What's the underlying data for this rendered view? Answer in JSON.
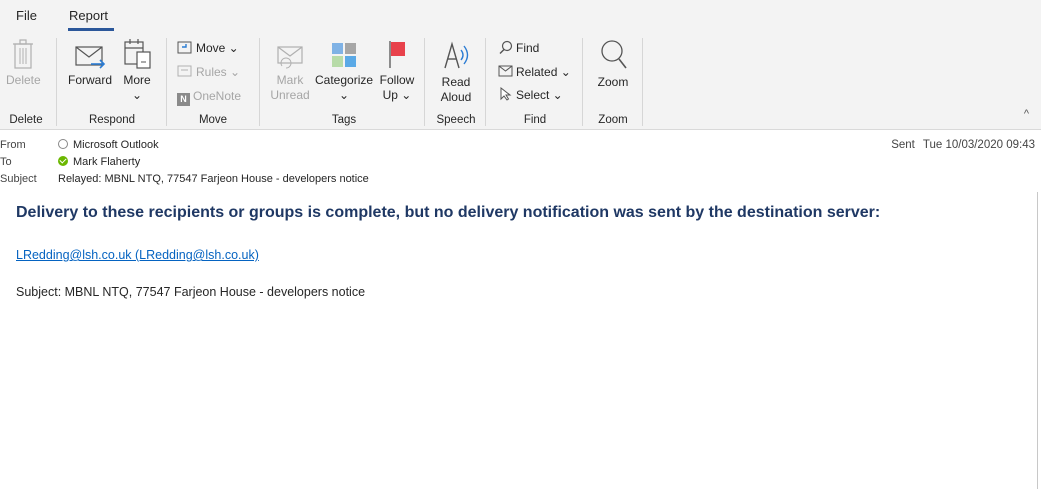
{
  "tabs": {
    "file": "File",
    "report": "Report"
  },
  "ribbon": {
    "delete": {
      "button": "Delete",
      "group": "Delete"
    },
    "respond": {
      "forward": "Forward",
      "more": "More",
      "more_arrow": "⌄",
      "group": "Respond"
    },
    "move": {
      "move": "Move ⌄",
      "rules": "Rules ⌄",
      "onenote": "OneNote",
      "group": "Move"
    },
    "tags": {
      "mark_unread_1": "Mark",
      "mark_unread_2": "Unread",
      "categorize": "Categorize",
      "categorize_arrow": "⌄",
      "follow_1": "Follow",
      "follow_2": "Up ⌄",
      "group": "Tags"
    },
    "speech": {
      "read_1": "Read",
      "read_2": "Aloud",
      "group": "Speech"
    },
    "find": {
      "find": "Find",
      "related": "Related ⌄",
      "select": "Select ⌄",
      "group": "Find"
    },
    "zoom": {
      "button": "Zoom",
      "group": "Zoom"
    },
    "collapse": "^"
  },
  "header": {
    "from_label": "From",
    "from_value": "Microsoft Outlook",
    "to_label": "To",
    "to_value": "Mark Flaherty",
    "subject_label": "Subject",
    "subject_value": "Relayed: MBNL NTQ, 77547 Farjeon House - developers notice",
    "sent_label": "Sent",
    "sent_value": "Tue 10/03/2020 09:43"
  },
  "body": {
    "notice": "Delivery to these recipients or groups is complete, but no delivery notification was sent by the destination server:",
    "recipient_link": "LRedding@lsh.co.uk (LRedding@lsh.co.uk)",
    "subject_line": "Subject: MBNL NTQ, 77547 Farjeon House - developers notice"
  },
  "colors": {
    "accent": "#2b579a",
    "notice": "#1f3864",
    "link": "#0563c1",
    "flag": "#e8414b"
  }
}
